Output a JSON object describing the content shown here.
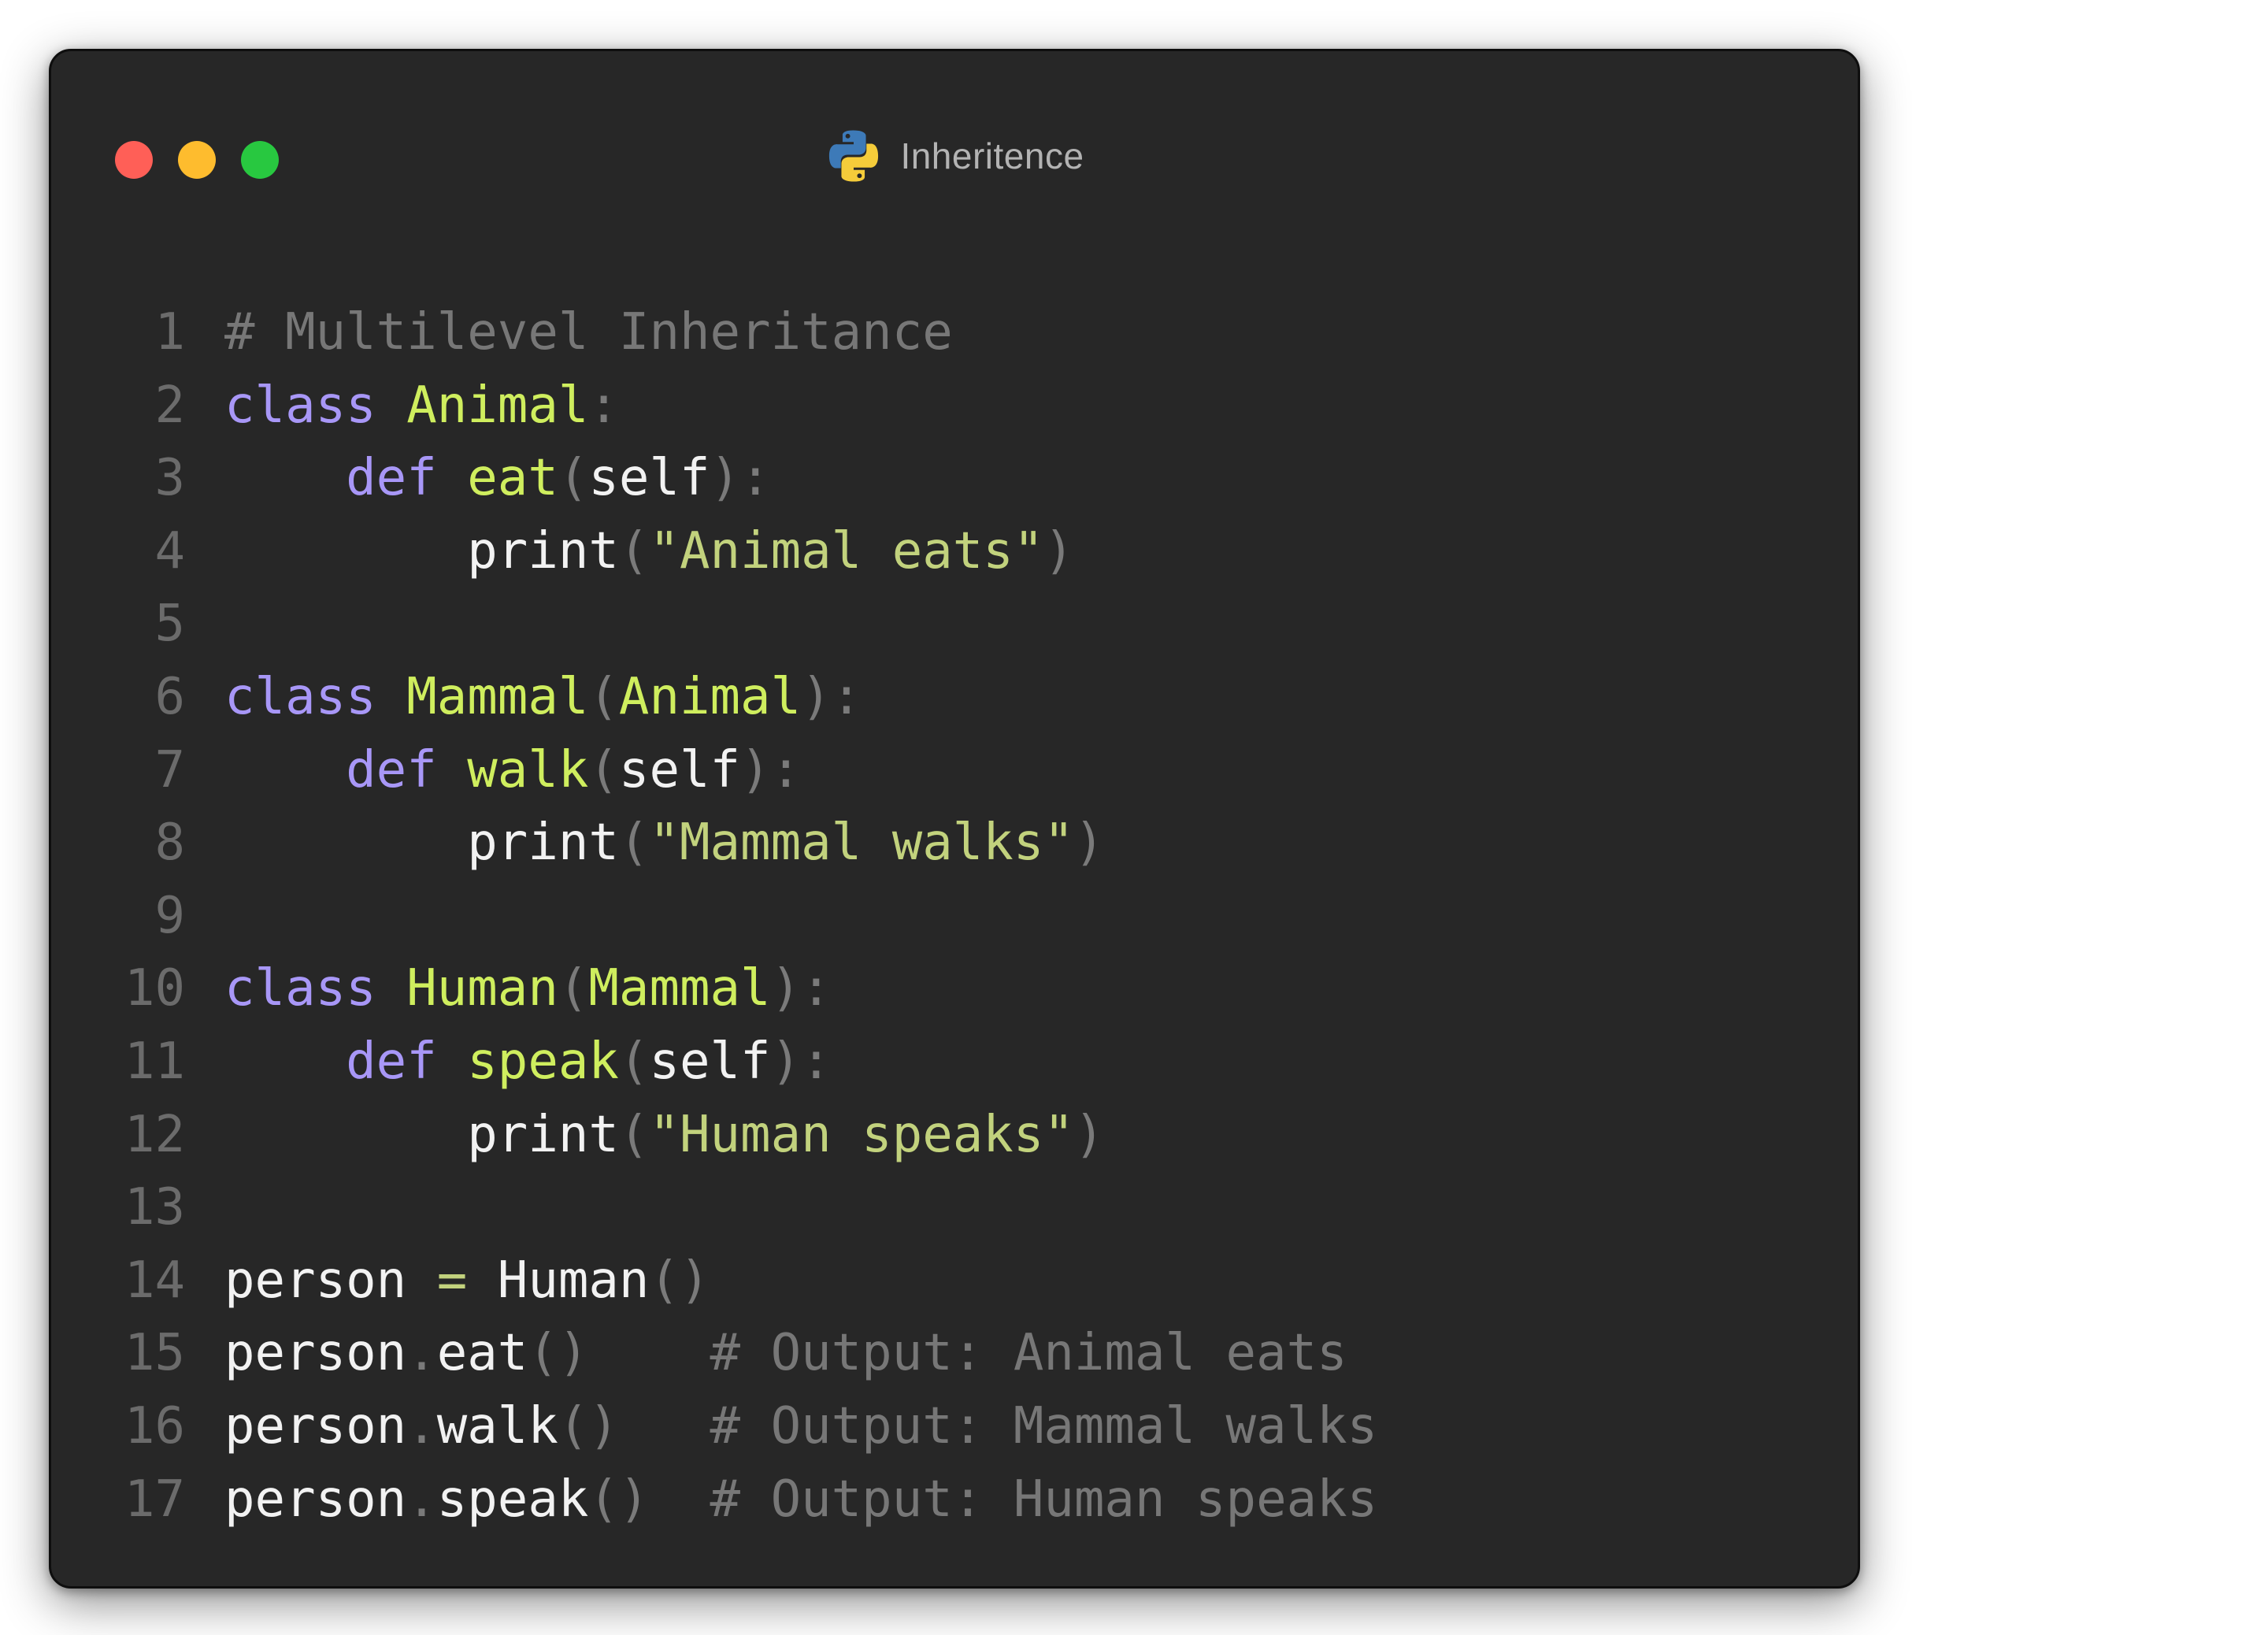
{
  "window": {
    "title": "Inheritence",
    "icon": "python-logo-icon",
    "traffic_lights": [
      {
        "name": "close",
        "color": "#ff5f57"
      },
      {
        "name": "minimize",
        "color": "#febc2e"
      },
      {
        "name": "maximize",
        "color": "#28c840"
      }
    ]
  },
  "theme": {
    "background": "#272727",
    "keyword": "#a897f7",
    "name": "#cfee5e",
    "string": "#c2d27d",
    "comment": "#777777",
    "text": "#f2f2f2",
    "line_number": "#6b6b6b"
  },
  "code": {
    "language": "python",
    "lines": [
      {
        "n": "1",
        "tokens": [
          {
            "t": "comment",
            "v": "# Multilevel Inheritance"
          }
        ]
      },
      {
        "n": "2",
        "tokens": [
          {
            "t": "kw",
            "v": "class"
          },
          {
            "t": "ws",
            "v": " "
          },
          {
            "t": "name",
            "v": "Animal"
          },
          {
            "t": "punc",
            "v": ":"
          }
        ]
      },
      {
        "n": "3",
        "tokens": [
          {
            "t": "ws",
            "v": "    "
          },
          {
            "t": "kw",
            "v": "def"
          },
          {
            "t": "ws",
            "v": " "
          },
          {
            "t": "name",
            "v": "eat"
          },
          {
            "t": "punc",
            "v": "("
          },
          {
            "t": "id",
            "v": "self"
          },
          {
            "t": "punc",
            "v": "):"
          }
        ]
      },
      {
        "n": "4",
        "tokens": [
          {
            "t": "ws",
            "v": "        "
          },
          {
            "t": "id",
            "v": "print"
          },
          {
            "t": "punc",
            "v": "("
          },
          {
            "t": "str",
            "v": "\"Animal eats\""
          },
          {
            "t": "punc",
            "v": ")"
          }
        ]
      },
      {
        "n": "5",
        "tokens": []
      },
      {
        "n": "6",
        "tokens": [
          {
            "t": "kw",
            "v": "class"
          },
          {
            "t": "ws",
            "v": " "
          },
          {
            "t": "name",
            "v": "Mammal"
          },
          {
            "t": "punc",
            "v": "("
          },
          {
            "t": "name",
            "v": "Animal"
          },
          {
            "t": "punc",
            "v": "):"
          }
        ]
      },
      {
        "n": "7",
        "tokens": [
          {
            "t": "ws",
            "v": "    "
          },
          {
            "t": "kw",
            "v": "def"
          },
          {
            "t": "ws",
            "v": " "
          },
          {
            "t": "name",
            "v": "walk"
          },
          {
            "t": "punc",
            "v": "("
          },
          {
            "t": "id",
            "v": "self"
          },
          {
            "t": "punc",
            "v": "):"
          }
        ]
      },
      {
        "n": "8",
        "tokens": [
          {
            "t": "ws",
            "v": "        "
          },
          {
            "t": "id",
            "v": "print"
          },
          {
            "t": "punc",
            "v": "("
          },
          {
            "t": "str",
            "v": "\"Mammal walks\""
          },
          {
            "t": "punc",
            "v": ")"
          }
        ]
      },
      {
        "n": "9",
        "tokens": []
      },
      {
        "n": "10",
        "tokens": [
          {
            "t": "kw",
            "v": "class"
          },
          {
            "t": "ws",
            "v": " "
          },
          {
            "t": "name",
            "v": "Human"
          },
          {
            "t": "punc",
            "v": "("
          },
          {
            "t": "name",
            "v": "Mammal"
          },
          {
            "t": "punc",
            "v": "):"
          }
        ]
      },
      {
        "n": "11",
        "tokens": [
          {
            "t": "ws",
            "v": "    "
          },
          {
            "t": "kw",
            "v": "def"
          },
          {
            "t": "ws",
            "v": " "
          },
          {
            "t": "name",
            "v": "speak"
          },
          {
            "t": "punc",
            "v": "("
          },
          {
            "t": "id",
            "v": "self"
          },
          {
            "t": "punc",
            "v": "):"
          }
        ]
      },
      {
        "n": "12",
        "tokens": [
          {
            "t": "ws",
            "v": "        "
          },
          {
            "t": "id",
            "v": "print"
          },
          {
            "t": "punc",
            "v": "("
          },
          {
            "t": "str",
            "v": "\"Human speaks\""
          },
          {
            "t": "punc",
            "v": ")"
          }
        ]
      },
      {
        "n": "13",
        "tokens": []
      },
      {
        "n": "14",
        "tokens": [
          {
            "t": "id",
            "v": "person"
          },
          {
            "t": "ws",
            "v": " "
          },
          {
            "t": "op",
            "v": "="
          },
          {
            "t": "ws",
            "v": " "
          },
          {
            "t": "id",
            "v": "Human"
          },
          {
            "t": "punc",
            "v": "()"
          }
        ]
      },
      {
        "n": "15",
        "tokens": [
          {
            "t": "id",
            "v": "person"
          },
          {
            "t": "punc",
            "v": "."
          },
          {
            "t": "id",
            "v": "eat"
          },
          {
            "t": "punc",
            "v": "()"
          },
          {
            "t": "ws",
            "v": "    "
          },
          {
            "t": "comment",
            "v": "# Output: Animal eats"
          }
        ]
      },
      {
        "n": "16",
        "tokens": [
          {
            "t": "id",
            "v": "person"
          },
          {
            "t": "punc",
            "v": "."
          },
          {
            "t": "id",
            "v": "walk"
          },
          {
            "t": "punc",
            "v": "()"
          },
          {
            "t": "ws",
            "v": "   "
          },
          {
            "t": "comment",
            "v": "# Output: Mammal walks"
          }
        ]
      },
      {
        "n": "17",
        "tokens": [
          {
            "t": "id",
            "v": "person"
          },
          {
            "t": "punc",
            "v": "."
          },
          {
            "t": "id",
            "v": "speak"
          },
          {
            "t": "punc",
            "v": "()"
          },
          {
            "t": "ws",
            "v": "  "
          },
          {
            "t": "comment",
            "v": "# Output: Human speaks"
          }
        ]
      }
    ]
  }
}
